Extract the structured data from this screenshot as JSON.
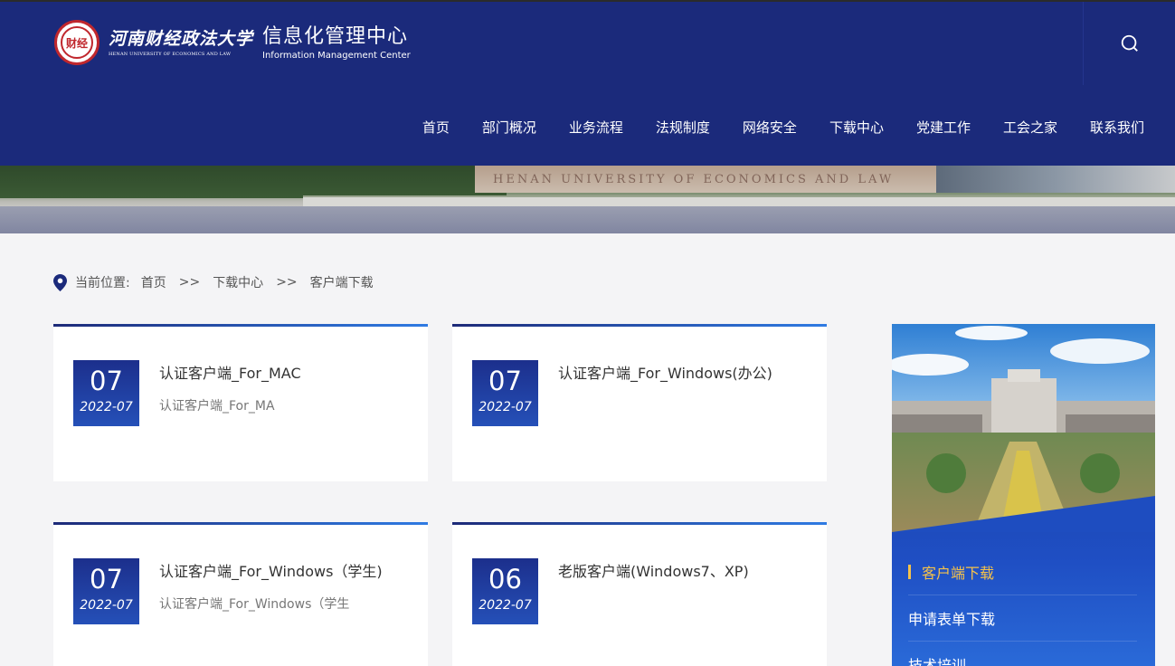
{
  "header": {
    "university_cn": "河南财经政法大学",
    "university_en": "HENAN UNIVERSITY OF ECONOMICS AND LAW",
    "center_cn": "信息化管理中心",
    "center_en": "Information Management Center",
    "seal_text": "财经",
    "nav": [
      "首页",
      "部门概况",
      "业务流程",
      "法规制度",
      "网络安全",
      "下载中心",
      "党建工作",
      "工会之家",
      "联系我们"
    ]
  },
  "banner": {
    "wall_text": "HENAN UNIVERSITY OF ECONOMICS AND LAW"
  },
  "breadcrumb": {
    "label": "当前位置:",
    "items": [
      "首页",
      "下载中心",
      "客户端下载"
    ],
    "separator": ">>"
  },
  "cards": [
    {
      "day": "07",
      "year_month": "2022-07",
      "title": "认证客户端_For_MAC",
      "summary": "认证客户端_For_MA"
    },
    {
      "day": "07",
      "year_month": "2022-07",
      "title": "认证客户端_For_Windows(办公)",
      "summary": ""
    },
    {
      "day": "07",
      "year_month": "2022-07",
      "title": "认证客户端_For_Windows（学生)",
      "summary": "认证客户端_For_Windows（学生"
    },
    {
      "day": "06",
      "year_month": "2022-07",
      "title": "老版客户端(Windows7、XP)",
      "summary": ""
    }
  ],
  "sidebar": {
    "items": [
      {
        "label": "客户端下载",
        "active": true
      },
      {
        "label": "申请表单下载",
        "active": false
      },
      {
        "label": "技术培训",
        "active": false
      }
    ]
  },
  "colors": {
    "header_bg": "#1b2a7b",
    "accent_blue": "#2f7be3",
    "active_gold": "#f5c24a",
    "seal_red": "#c0272d"
  },
  "icons": [
    "search-icon",
    "location-pin-icon",
    "university-seal-icon"
  ]
}
